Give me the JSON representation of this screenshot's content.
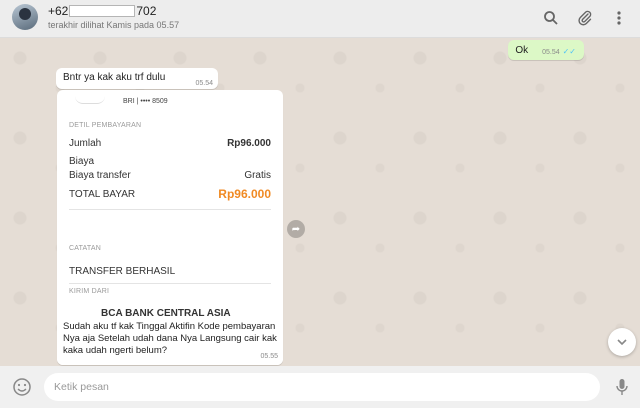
{
  "header": {
    "contact_prefix": "+62",
    "contact_suffix": "702",
    "last_seen": "terakhir dilihat Kamis pada 05.57"
  },
  "messages": {
    "outgoing_ok": {
      "text": "Ok",
      "time": "05.54",
      "ticks": "✓✓"
    },
    "incoming_1": {
      "text": "Bntr ya kak aku trf dulu",
      "time": "05.54"
    },
    "receipt": {
      "bank_account": "BRI | •••• 8509",
      "section_payment": "DETIL PEMBAYARAN",
      "amount_label": "Jumlah",
      "amount_value": "Rp96.000",
      "fee_label": "Biaya",
      "transfer_fee_label": "Biaya transfer",
      "transfer_fee_value": "Gratis",
      "total_label": "TOTAL BAYAR",
      "total_value": "Rp96.000",
      "section_notes": "CATATAN",
      "note": "TRANSFER BERHASIL",
      "section_from": "KIRIM DARI",
      "from_bank": "BCA BANK CENTRAL ASIA"
    },
    "caption": {
      "text": "Sudah aku tf kak Tinggal Aktifin Kode pembayaran Nya aja Setelah udah dana Nya Langsung cair kak kaka udah ngerti belum?",
      "time": "05.55"
    }
  },
  "footer": {
    "placeholder": "Ketik pesan"
  },
  "icons": {
    "search": "search-icon",
    "attach": "paperclip-icon",
    "menu": "kebab-menu-icon",
    "emoji": "emoji-icon",
    "mic": "microphone-icon",
    "forward": "forward-icon",
    "scroll_down": "chevron-down-icon"
  }
}
